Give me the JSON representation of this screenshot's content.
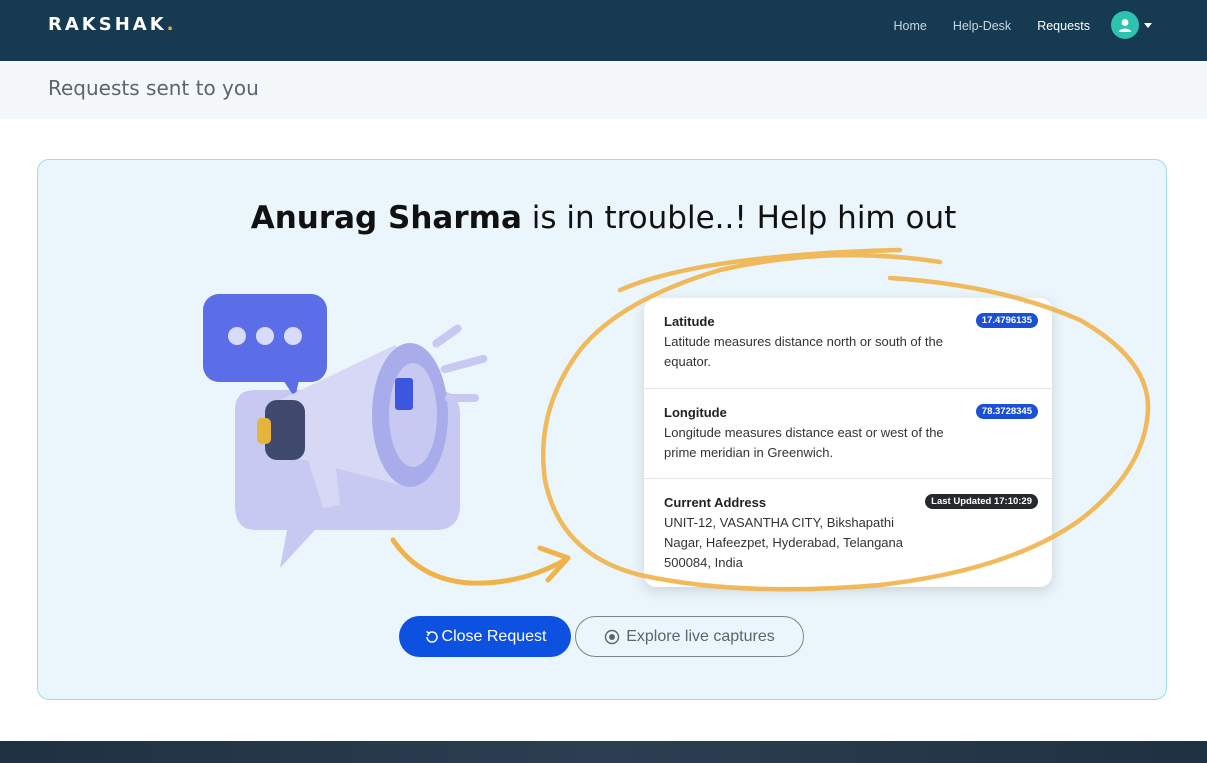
{
  "brand": {
    "name": "RAKSHAK",
    "dot": "."
  },
  "nav": {
    "links": [
      "Home",
      "Help-Desk",
      "Requests"
    ],
    "active": "Requests",
    "avatar_icon": "user-avatar-icon"
  },
  "page_title": "Requests sent to you",
  "alert": {
    "name": "Anurag Sharma",
    "message": " is in trouble..! Help him out"
  },
  "location": {
    "latitude": {
      "title": "Latitude",
      "value": "17.4796135",
      "description": "Latitude measures distance north or south of the equator."
    },
    "longitude": {
      "title": "Longitude",
      "value": "78.3728345",
      "description": "Longitude measures distance east or west of the prime meridian in Greenwich."
    },
    "address": {
      "title": "Current Address",
      "badge": "Last Updated 17:10:29",
      "text": "UNIT-12, VASANTHA CITY, Bikshapathi Nagar, Hafeezpet, Hyderabad, Telangana 500084, India"
    }
  },
  "actions": {
    "close_label": "Close Request",
    "explore_label": "Explore live captures"
  },
  "colors": {
    "navbar": "#153a52",
    "accent": "#0d51e0",
    "card_bg": "#eaf6fb",
    "highlight": "#f0b34a"
  }
}
